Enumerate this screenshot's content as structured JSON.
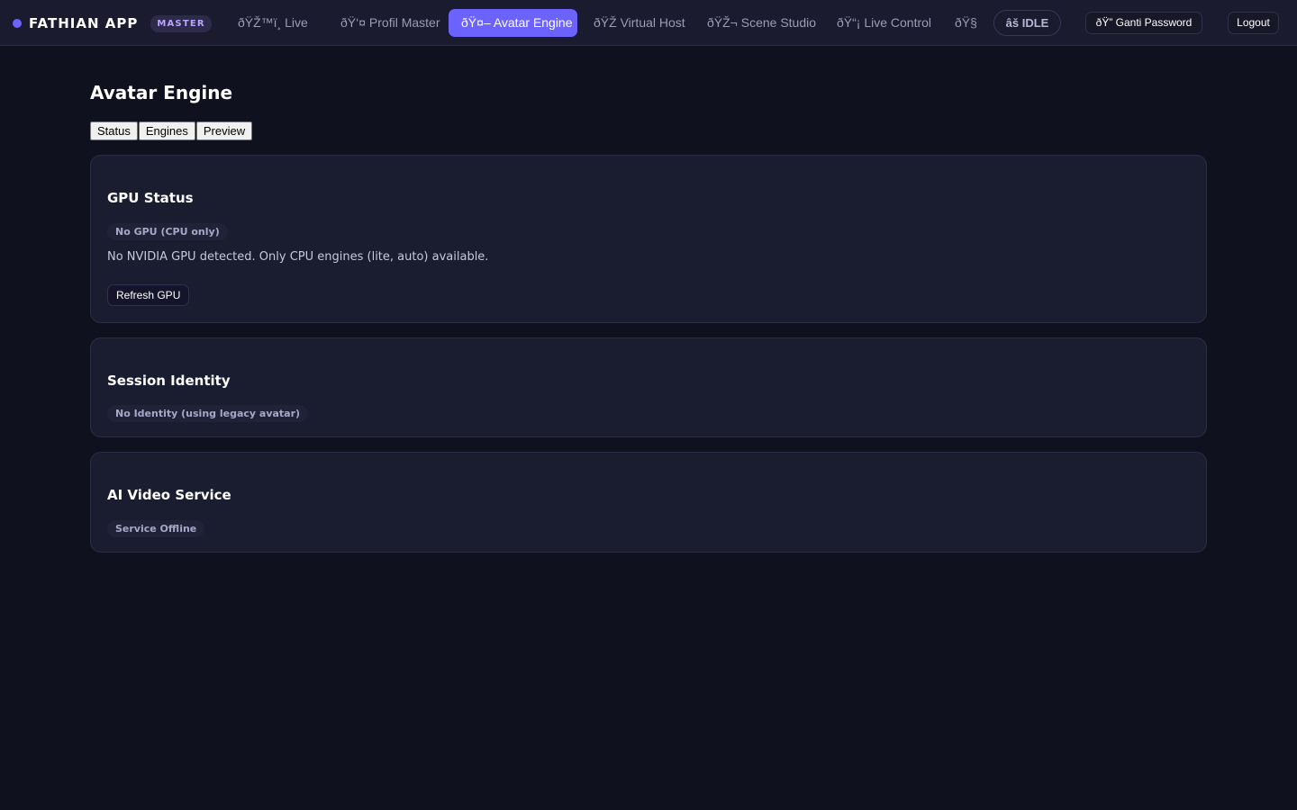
{
  "app": {
    "name": "FATHIAN APP",
    "role_badge": "MASTER"
  },
  "nav": {
    "items": [
      {
        "label": "ðŸŽ™ï¸ Live"
      },
      {
        "label": "ðŸ‘¤ Profil Master"
      },
      {
        "label": "ðŸ¤– Avatar Engine",
        "active": true
      },
      {
        "label": "ðŸŽ Virtual Host"
      },
      {
        "label": "ðŸŽ¬ Scene Studio"
      },
      {
        "label": "ðŸ“¡ Live Control"
      },
      {
        "label": "ðŸ§"
      }
    ],
    "status": "âš IDLE",
    "change_password": "ðŸ” Ganti Password",
    "logout": "Logout"
  },
  "page": {
    "title": "Avatar Engine",
    "tabs": [
      "Status",
      "Engines",
      "Preview"
    ]
  },
  "gpu_card": {
    "title": "GPU Status",
    "badge": "No GPU (CPU only)",
    "message": "No NVIDIA GPU detected. Only CPU engines (lite, auto) available.",
    "refresh_button": "Refresh GPU"
  },
  "identity_card": {
    "title": "Session Identity",
    "badge": "No Identity (using legacy avatar)"
  },
  "video_card": {
    "title": "AI Video Service",
    "badge": "Service Offline"
  },
  "colors": {
    "background": "#10111f",
    "topbar": "#1a1b2e",
    "accent": "#6c63ff",
    "card": "#1a1c30"
  }
}
